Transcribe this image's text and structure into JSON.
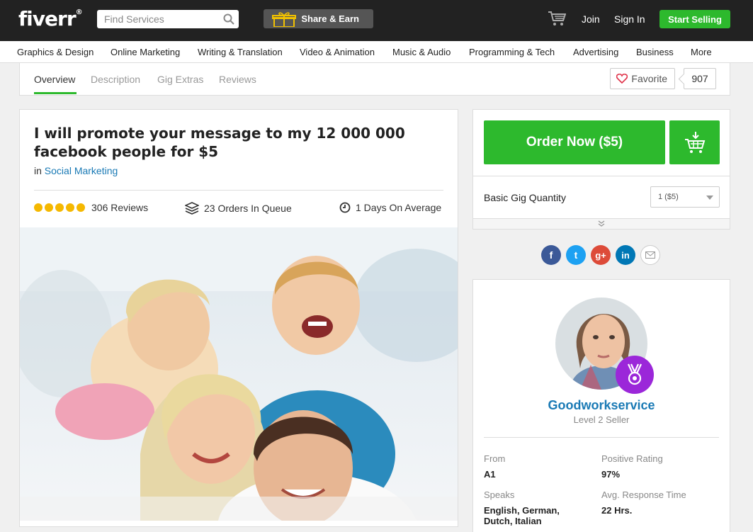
{
  "header": {
    "logo": "fiverr",
    "logo_mark": "®",
    "search_placeholder": "Find Services",
    "share_label": "Share & Earn",
    "join_label": "Join",
    "signin_label": "Sign In",
    "start_selling_label": "Start Selling"
  },
  "categories": [
    "Graphics & Design",
    "Online Marketing",
    "Writing & Translation",
    "Video & Animation",
    "Music & Audio",
    "Programming & Tech",
    "Advertising",
    "Business",
    "More"
  ],
  "tabs": [
    "Overview",
    "Description",
    "Gig Extras",
    "Reviews"
  ],
  "favorite": {
    "label": "Favorite",
    "count": "907"
  },
  "gig": {
    "title": "I will promote your message to my 12 000 000 facebook people for $5",
    "category_prefix": "in",
    "category": "Social Marketing",
    "rating_stars": 5,
    "reviews": "306 Reviews",
    "queue": "23 Orders In Queue",
    "delivery": "1 Days On Average"
  },
  "order": {
    "button_label": "Order Now ($5)",
    "quantity_label": "Basic Gig Quantity",
    "quantity_value": "1 ($5)"
  },
  "social": [
    {
      "name": "facebook",
      "glyph": "f",
      "color": "#3b5998"
    },
    {
      "name": "twitter",
      "glyph": "t",
      "color": "#1da1f2"
    },
    {
      "name": "google-plus",
      "glyph": "g+",
      "color": "#dd4b39"
    },
    {
      "name": "linkedin",
      "glyph": "in",
      "color": "#0077b5"
    }
  ],
  "seller": {
    "name": "Goodworkservice",
    "level": "Level 2 Seller",
    "from_label": "From",
    "from_value": "A1",
    "rating_label": "Positive Rating",
    "rating_value": "97%",
    "speaks_label": "Speaks",
    "speaks_value": "English, German, Dutch, Italian",
    "response_label": "Avg. Response Time",
    "response_value": "22 Hrs."
  },
  "colors": {
    "brand_green": "#2db92d",
    "link_blue": "#1a7ab5",
    "badge_purple": "#9b27d9",
    "star_yellow": "#f5b800"
  }
}
